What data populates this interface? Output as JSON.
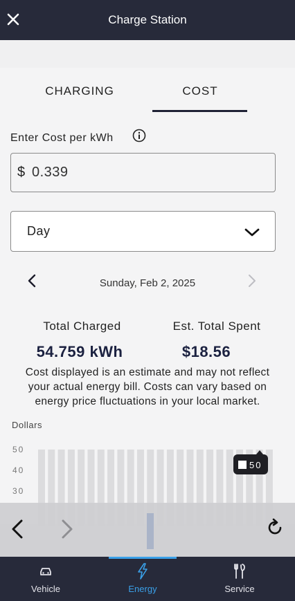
{
  "header": {
    "title": "Charge Station",
    "close_icon": "close-icon"
  },
  "tabs": [
    {
      "label": "CHARGING",
      "active": false
    },
    {
      "label": "COST",
      "active": true
    }
  ],
  "cost_input": {
    "label": "Enter Cost per kWh",
    "currency": "$",
    "value": "0.339",
    "info_icon": "info-icon"
  },
  "period_select": {
    "selected": "Day",
    "icon": "chevron-down-icon"
  },
  "date_nav": {
    "date": "Sunday, Feb 2, 2025",
    "prev_icon": "chevron-left-icon",
    "next_icon": "chevron-right-icon",
    "next_enabled": false
  },
  "summary": {
    "total_charged_label": "Total Charged",
    "total_charged_value": "54.759 kWh",
    "total_spent_label": "Est. Total Spent",
    "total_spent_value": "$18.56"
  },
  "disclaimer_lines": [
    "Cost displayed is an estimate and may not reflect",
    "your actual energy bill. Costs can vary based on",
    "energy price fluctuations in your local market."
  ],
  "chart_data": {
    "type": "bar",
    "ylabel": "Dollars",
    "yticks": [
      "50",
      "40",
      "30"
    ],
    "ylim": [
      0,
      50
    ],
    "bar_count": 24,
    "values": [
      50,
      50,
      50,
      50,
      50,
      50,
      50,
      50,
      50,
      50,
      50,
      50,
      50,
      50,
      50,
      50,
      50,
      50,
      50,
      50,
      50,
      50,
      50,
      50
    ],
    "tooltip": "50",
    "bar_color": "#dcdcde"
  },
  "browser_bar": {
    "back_icon": "back-arrow-icon",
    "forward_icon": "forward-arrow-icon",
    "reload_icon": "reload-icon"
  },
  "bottom_nav": [
    {
      "label": "Vehicle",
      "icon": "car-icon",
      "active": false
    },
    {
      "label": "Energy",
      "icon": "lightning-icon",
      "active": true
    },
    {
      "label": "Service",
      "icon": "tools-icon",
      "active": false
    }
  ],
  "colors": {
    "header_bg": "#272a3a",
    "accent": "#3aa0e8",
    "value_text": "#1b2140"
  }
}
